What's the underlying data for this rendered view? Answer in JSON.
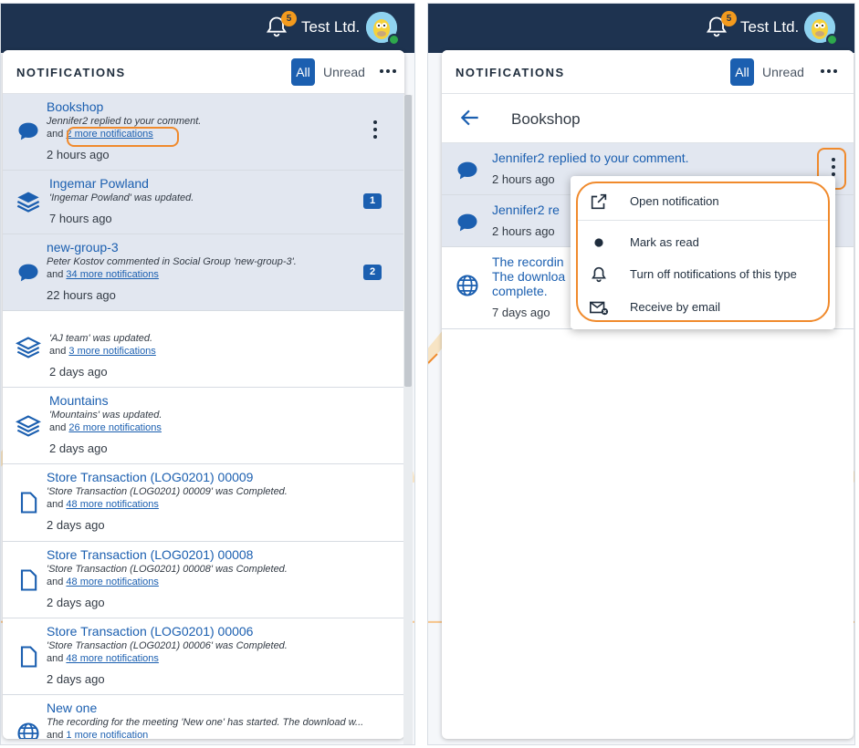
{
  "colors": {
    "topbar": "#1e3350",
    "accent": "#1b5fb0",
    "badge": "#f39a1d",
    "highlight": "#f08a2c",
    "unread_bg": "#e2e7f0"
  },
  "left": {
    "topbar": {
      "bell_count": "5",
      "company": "Test Ltd."
    },
    "header": {
      "title": "NOTIFICATIONS",
      "all_label": "All",
      "unread_label": "Unread"
    },
    "items": [
      {
        "icon": "comment-icon",
        "title": "Bookshop",
        "desc": "Jennifer2 replied to your comment.",
        "more_prefix": "and",
        "more_link": "2 more notifications",
        "time": "2 hours ago"
      },
      {
        "icon": "layers-icon",
        "title": "Ingemar Powland",
        "desc": "'Ingemar Powland' was updated.",
        "time": "7 hours ago",
        "count": "1"
      },
      {
        "icon": "comment-icon",
        "title": "new-group-3",
        "desc": "Peter Kostov commented in Social Group 'new-group-3'.",
        "more_prefix": "and",
        "more_link": "34 more notifications",
        "time": "22 hours ago",
        "count": "2"
      },
      {
        "icon": "layers-icon",
        "title": "",
        "desc": "'AJ team' was updated.",
        "more_prefix": "and",
        "more_link": "3 more notifications",
        "time": "2 days ago"
      },
      {
        "icon": "layers-icon",
        "title": "Mountains",
        "desc": "'Mountains' was updated.",
        "more_prefix": "and",
        "more_link": "26 more notifications",
        "time": "2 days ago"
      },
      {
        "icon": "document-icon",
        "title": "Store Transaction (LOG0201) 00009",
        "desc": "'Store Transaction (LOG0201) 00009' was Completed.",
        "more_prefix": "and",
        "more_link": "48 more notifications",
        "time": "2 days ago"
      },
      {
        "icon": "document-icon",
        "title": "Store Transaction (LOG0201) 00008",
        "desc": "'Store Transaction (LOG0201) 00008' was Completed.",
        "more_prefix": "and",
        "more_link": "48 more notifications",
        "time": "2 days ago"
      },
      {
        "icon": "document-icon",
        "title": "Store Transaction (LOG0201) 00006",
        "desc": "'Store Transaction (LOG0201) 00006' was Completed.",
        "more_prefix": "and",
        "more_link": "48 more notifications",
        "time": "2 days ago"
      },
      {
        "icon": "globe-icon",
        "title": "New one",
        "desc": "The recording for the meeting 'New one' has started. The download w...",
        "more_prefix": "and",
        "more_link": "1 more notification",
        "time": ""
      }
    ]
  },
  "right": {
    "topbar": {
      "bell_count": "5",
      "company": "Test Ltd."
    },
    "header": {
      "title": "NOTIFICATIONS",
      "all_label": "All",
      "unread_label": "Unread"
    },
    "sub_title": "Bookshop",
    "items": [
      {
        "icon": "comment-icon",
        "title": "Jennifer2 replied to your comment.",
        "time": "2 hours ago"
      },
      {
        "icon": "comment-icon",
        "title": "Jennifer2 re",
        "time": "2 hours ago"
      },
      {
        "icon": "globe-icon",
        "title_lines": [
          "The recordin",
          "The downloa",
          "complete."
        ],
        "time": "7 days ago"
      }
    ],
    "menu": [
      {
        "icon": "external-link-icon",
        "label": "Open notification"
      },
      {
        "icon": "dot-icon",
        "label": "Mark as read"
      },
      {
        "icon": "bell-icon",
        "label": "Turn off notifications of this type"
      },
      {
        "icon": "email-off-icon",
        "label": "Receive by email"
      }
    ]
  }
}
